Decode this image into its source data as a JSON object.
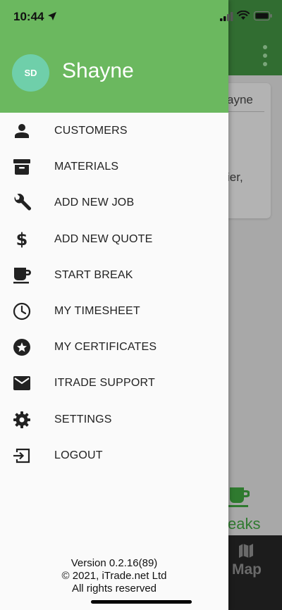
{
  "status_bar": {
    "time": "10:44",
    "icons": [
      "location-arrow-icon",
      "cellular-signal-icon",
      "wifi-icon",
      "battery-icon"
    ]
  },
  "background_app": {
    "header_menu_icon": "more-vert-icon",
    "card": {
      "name_fragment": "ayne",
      "text_fragment": "ier,"
    },
    "tab_breaks": {
      "label": "eaks",
      "icon": "coffee-icon"
    },
    "tab_map": {
      "label": "Map",
      "icon": "map-icon"
    }
  },
  "drawer": {
    "user": {
      "initials": "SD",
      "name": "Shayne"
    },
    "items": [
      {
        "label": "CUSTOMERS",
        "icon": "person-icon"
      },
      {
        "label": "MATERIALS",
        "icon": "archive-box-icon"
      },
      {
        "label": "ADD NEW JOB",
        "icon": "wrench-icon"
      },
      {
        "label": "ADD NEW QUOTE",
        "icon": "dollar-icon"
      },
      {
        "label": "START BREAK",
        "icon": "coffee-icon"
      },
      {
        "label": "MY TIMESHEET",
        "icon": "clock-icon"
      },
      {
        "label": "MY CERTIFICATES",
        "icon": "star-badge-icon"
      },
      {
        "label": "ITRADE SUPPORT",
        "icon": "mail-icon"
      },
      {
        "label": "SETTINGS",
        "icon": "gear-icon"
      },
      {
        "label": "LOGOUT",
        "icon": "logout-icon"
      }
    ],
    "footer": {
      "version": "Version 0.2.16(89)",
      "copyright": "© 2021, iTrade.net Ltd",
      "rights": "All rights reserved"
    }
  },
  "colors": {
    "drawer_header": "#6bb85f",
    "avatar": "#6fcfaa",
    "app_header_dimmed": "#316d31",
    "icon": "#222222"
  }
}
